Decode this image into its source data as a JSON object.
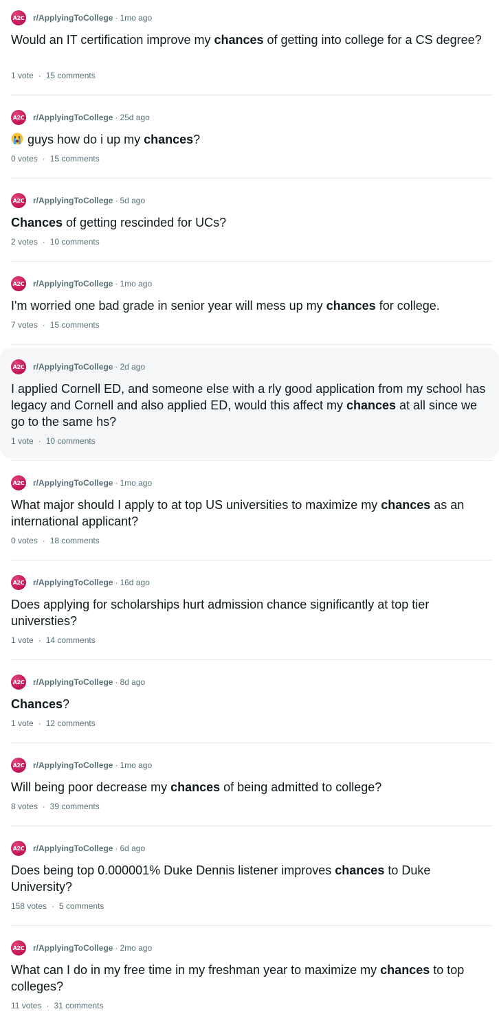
{
  "subreddit_icon_text": "A2C",
  "separator": "·",
  "posts": [
    {
      "subreddit": "r/ApplyingToCollege",
      "time": "1mo ago",
      "title": [
        {
          "t": "Would an IT certification improve my "
        },
        {
          "t": "chances",
          "b": true
        },
        {
          "t": " of getting into college for a CS degree?"
        }
      ],
      "votes": "1 vote",
      "comments": "15 comments"
    },
    {
      "subreddit": "r/ApplyingToCollege",
      "time": "25d ago",
      "emoji": "crying-face",
      "title": [
        {
          "t": "guys how do i up my "
        },
        {
          "t": "chances",
          "b": true
        },
        {
          "t": "?"
        }
      ],
      "votes": "0 votes",
      "comments": "15 comments"
    },
    {
      "subreddit": "r/ApplyingToCollege",
      "time": "5d ago",
      "title": [
        {
          "t": "Chances",
          "b": true
        },
        {
          "t": " of getting rescinded for UCs?"
        }
      ],
      "votes": "2 votes",
      "comments": "10 comments"
    },
    {
      "subreddit": "r/ApplyingToCollege",
      "time": "1mo ago",
      "title": [
        {
          "t": "I'm worried one bad grade in senior year will mess up my "
        },
        {
          "t": "chances",
          "b": true
        },
        {
          "t": " for college."
        }
      ],
      "votes": "7 votes",
      "comments": "15 comments"
    },
    {
      "subreddit": "r/ApplyingToCollege",
      "time": "2d ago",
      "hovered": true,
      "title": [
        {
          "t": "I applied Cornell ED, and someone else with a rly good application from my school has legacy and Cornell and also applied ED, would this affect my "
        },
        {
          "t": "chances",
          "b": true
        },
        {
          "t": " at all since we go to the same hs?"
        }
      ],
      "votes": "1 vote",
      "comments": "10 comments"
    },
    {
      "subreddit": "r/ApplyingToCollege",
      "time": "1mo ago",
      "title": [
        {
          "t": "What major should I apply to at top US universities to maximize my "
        },
        {
          "t": "chances",
          "b": true
        },
        {
          "t": " as an international applicant?"
        }
      ],
      "votes": "0 votes",
      "comments": "18 comments"
    },
    {
      "subreddit": "r/ApplyingToCollege",
      "time": "16d ago",
      "title": [
        {
          "t": "Does applying for scholarships hurt admission chance significantly at top tier universties?"
        }
      ],
      "votes": "1 vote",
      "comments": "14 comments"
    },
    {
      "subreddit": "r/ApplyingToCollege",
      "time": "8d ago",
      "title": [
        {
          "t": "Chances",
          "b": true
        },
        {
          "t": "?"
        }
      ],
      "votes": "1 vote",
      "comments": "12 comments"
    },
    {
      "subreddit": "r/ApplyingToCollege",
      "time": "1mo ago",
      "title": [
        {
          "t": "Will being poor decrease my "
        },
        {
          "t": "chances",
          "b": true
        },
        {
          "t": " of being admitted to college?"
        }
      ],
      "votes": "8 votes",
      "comments": "39 comments"
    },
    {
      "subreddit": "r/ApplyingToCollege",
      "time": "6d ago",
      "title": [
        {
          "t": "Does being top 0.000001% Duke Dennis listener improves "
        },
        {
          "t": "chances",
          "b": true
        },
        {
          "t": " to Duke University?"
        }
      ],
      "votes": "158 votes",
      "comments": "5 comments"
    },
    {
      "subreddit": "r/ApplyingToCollege",
      "time": "2mo ago",
      "title": [
        {
          "t": "What can I do in my free time in my freshman year to maximize my "
        },
        {
          "t": "chances",
          "b": true
        },
        {
          "t": " to top colleges?"
        }
      ],
      "votes": "11 votes",
      "comments": "31 comments"
    }
  ]
}
